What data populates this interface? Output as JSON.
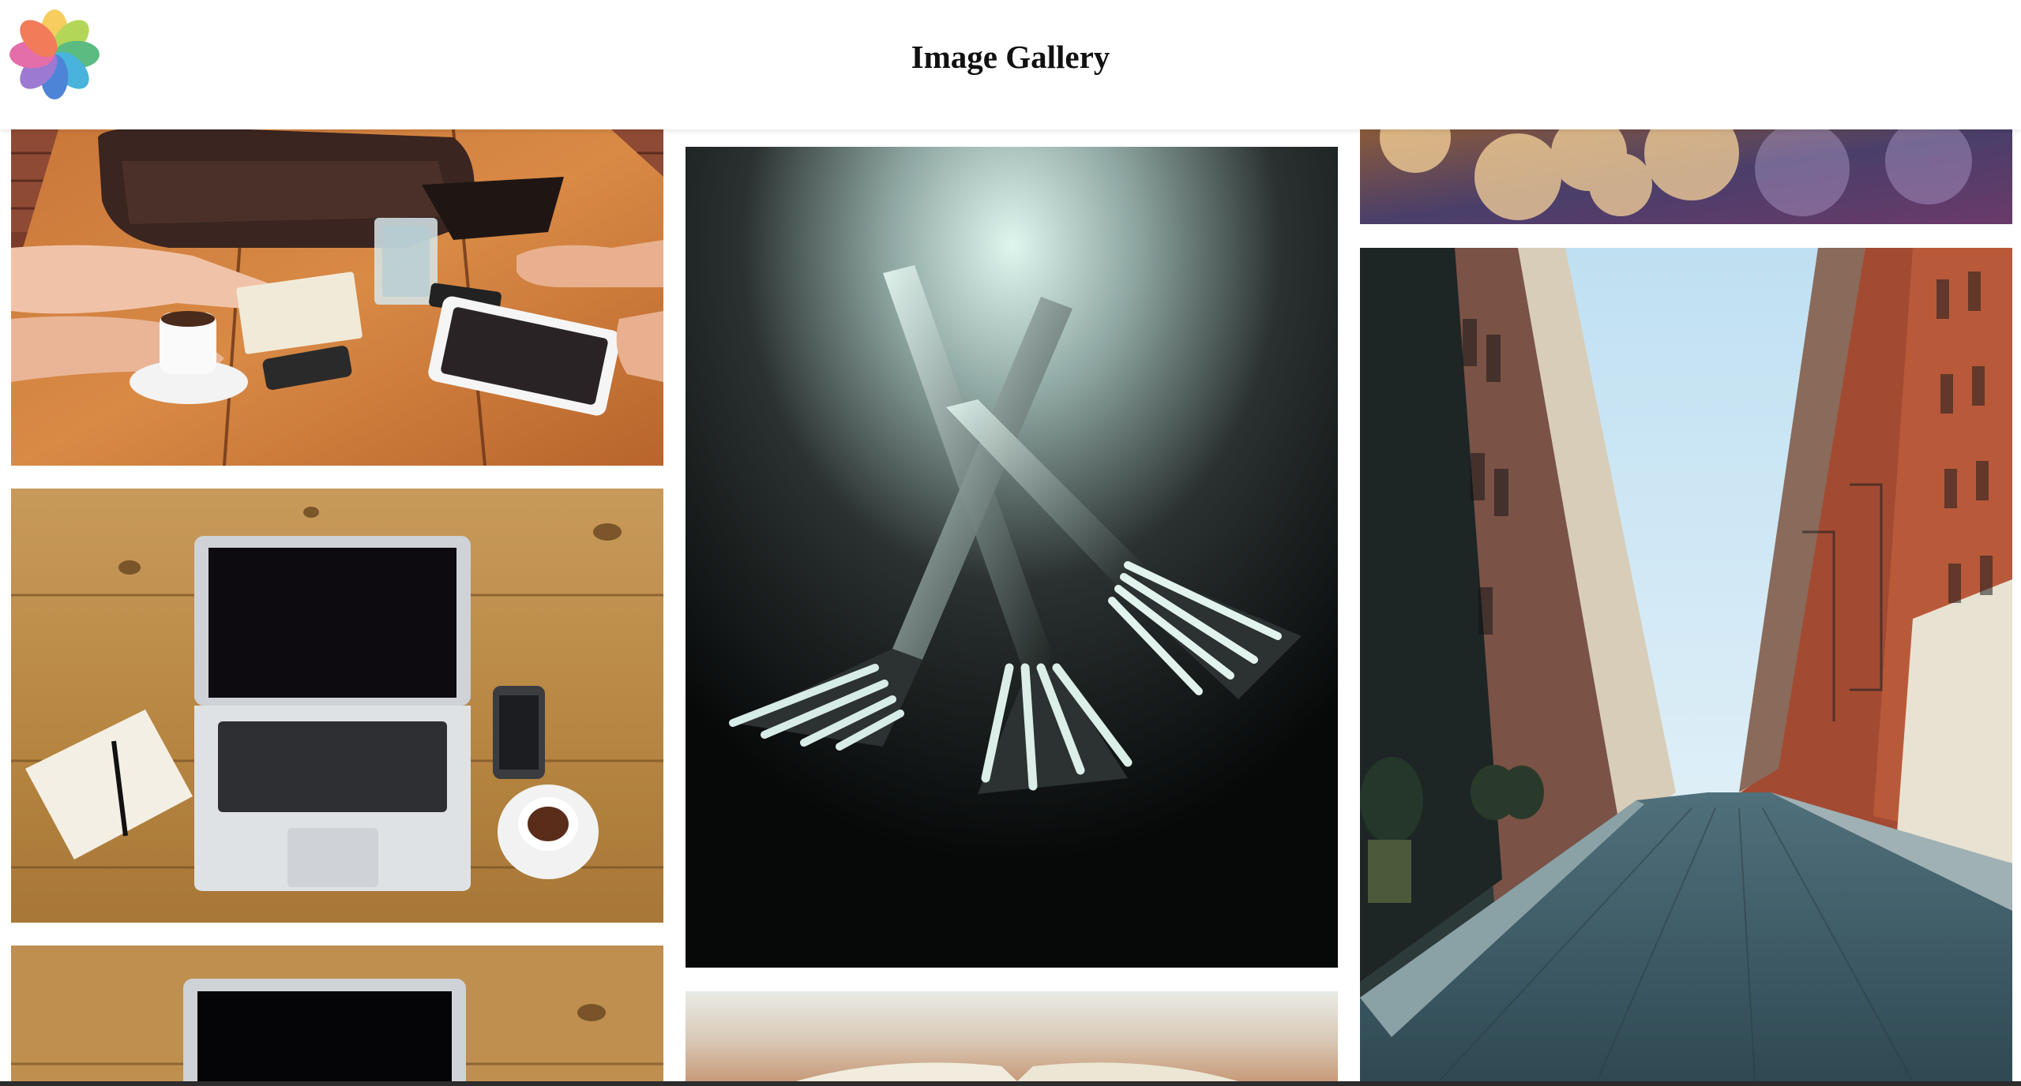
{
  "header": {
    "title": "Image Gallery",
    "logo_icon": "photos-flower-icon",
    "logo_colors": [
      "#f5c542",
      "#a6cf3b",
      "#3fb06b",
      "#2aa6d8",
      "#2f6fd1",
      "#8d63c9",
      "#e0559b",
      "#f0643e"
    ]
  },
  "gallery": {
    "background": "#ffffff",
    "columns": [
      {
        "images": [
          {
            "subject": "meeting-table-photo"
          },
          {
            "subject": "laptop-desk-photo"
          },
          {
            "subject": "laptop-desk-photo"
          }
        ]
      },
      {
        "images": [
          {
            "subject": "forks-photo"
          },
          {
            "subject": "book-photo"
          }
        ]
      },
      {
        "images": [
          {
            "subject": "bokeh-lights-photo"
          },
          {
            "subject": "city-street-photo"
          }
        ]
      }
    ]
  }
}
